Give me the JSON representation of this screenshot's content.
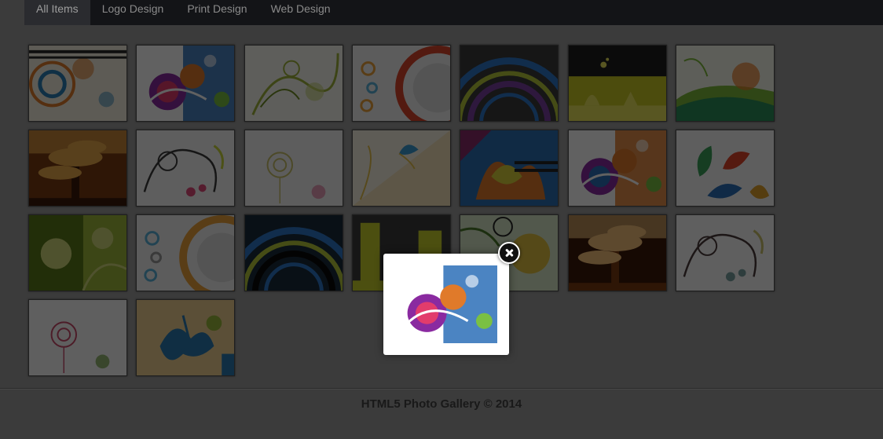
{
  "nav": {
    "items": [
      {
        "label": "All Items",
        "active": true
      },
      {
        "label": "Logo Design",
        "active": false
      },
      {
        "label": "Print Design",
        "active": false
      },
      {
        "label": "Web Design",
        "active": false
      }
    ]
  },
  "gallery": {
    "thumbnails": [
      {
        "motif": "swirl-circles",
        "colors": [
          "#f3efe0",
          "#e07b2a",
          "#2b7fb6",
          "#2a2a2a"
        ]
      },
      {
        "motif": "floral-burst",
        "colors": [
          "#ffffff",
          "#8a2aa0",
          "#2c6fb7",
          "#e23c6c"
        ]
      },
      {
        "motif": "vines",
        "colors": [
          "#f7f7ee",
          "#9fb33a",
          "#6f8d24",
          "#c8d37a"
        ]
      },
      {
        "motif": "rings",
        "colors": [
          "#f2f2f2",
          "#d9462a",
          "#e9a03a",
          "#5ab0d8"
        ]
      },
      {
        "motif": "arcs",
        "colors": [
          "#3a3a3a",
          "#2e78c8",
          "#b5c93a",
          "#7a3fa0"
        ]
      },
      {
        "motif": "silhouette",
        "colors": [
          "#c7c824",
          "#9fb02a",
          "#1f1f1f",
          "#e6e35a"
        ]
      },
      {
        "motif": "waves",
        "colors": [
          "#f5f7e9",
          "#7cb83a",
          "#e87a2a",
          "#2a8f5a"
        ]
      },
      {
        "motif": "tree",
        "colors": [
          "#c77b2a",
          "#7a3a12",
          "#e8a84a",
          "#3a1a08"
        ]
      },
      {
        "motif": "floral-line",
        "colors": [
          "#f6f6f6",
          "#3a3a3a",
          "#e04a7a",
          "#c8d53a"
        ]
      },
      {
        "motif": "rose-outline",
        "colors": [
          "#f4f4f4",
          "#c8c06a",
          "#e07aa0",
          "#f9f9f9"
        ]
      },
      {
        "motif": "butterfly",
        "colors": [
          "#f7f1e3",
          "#e4c04a",
          "#3a9bd1",
          "#f0d8a0"
        ]
      },
      {
        "motif": "lily",
        "colors": [
          "#2a6fb3",
          "#d8d03a",
          "#e07a2a",
          "#8a2a6a"
        ]
      },
      {
        "motif": "floral-burst",
        "colors": [
          "#ffffff",
          "#8a2aa0",
          "#e07a2a",
          "#2c6fb7"
        ]
      },
      {
        "motif": "drops",
        "colors": [
          "#f7f7f7",
          "#3aa05a",
          "#e0462a",
          "#2a6fb7"
        ]
      },
      {
        "motif": "grunge-green",
        "colors": [
          "#9fb83a",
          "#5a7a1a",
          "#d0d77a",
          "#ffffff"
        ]
      },
      {
        "motif": "rings",
        "colors": [
          "#f2f2f2",
          "#e9a03a",
          "#5ab0d8",
          "#9a9a9a"
        ]
      },
      {
        "motif": "arcs",
        "colors": [
          "#1a2a3a",
          "#2e78c8",
          "#b5c93a",
          "#0a0a0a"
        ]
      },
      {
        "motif": "city",
        "colors": [
          "#1f1f1f",
          "#c8cf2a",
          "#3a3a3a",
          "#e6e35a"
        ]
      },
      {
        "motif": "flowers",
        "colors": [
          "#d8e8c8",
          "#f5f5f0",
          "#e0c040",
          "#4a7a2a"
        ]
      },
      {
        "motif": "tree",
        "colors": [
          "#e0a04a",
          "#3a1a08",
          "#f4c07a",
          "#7a3a12"
        ]
      },
      {
        "motif": "floral-line",
        "colors": [
          "#f9f9f9",
          "#4a3a3a",
          "#7aa0a0",
          "#c8c06a"
        ]
      },
      {
        "motif": "rose-outline",
        "colors": [
          "#fafafa",
          "#c84a6a",
          "#6a9a3a",
          "#e0c080"
        ]
      },
      {
        "motif": "splash",
        "colors": [
          "#f0d090",
          "#e08a2a",
          "#2a7ab0",
          "#9ab83a"
        ]
      }
    ]
  },
  "lightbox": {
    "preview_motif": "floral-burst",
    "preview_colors": [
      "#ffffff",
      "#8a2aa0",
      "#2c6fb7",
      "#e23c6c"
    ],
    "close_icon": "close-icon"
  },
  "footer": {
    "text": "HTML5 Photo Gallery © 2014"
  }
}
